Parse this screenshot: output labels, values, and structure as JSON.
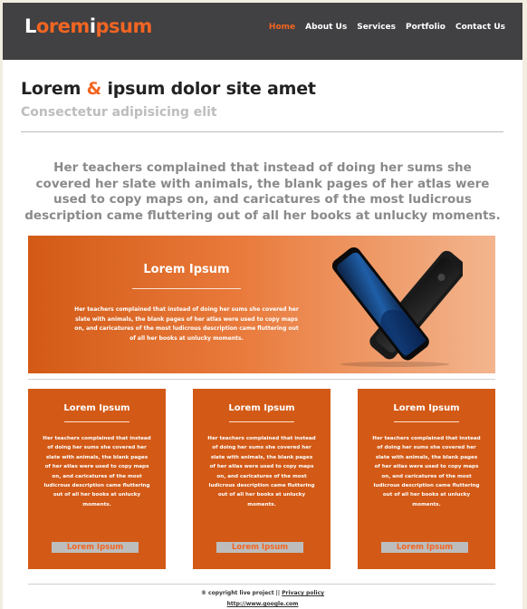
{
  "header": {
    "logo": {
      "part1": "L",
      "part2": "orem",
      "part3": "i",
      "part4": "psum"
    },
    "nav": [
      "Home",
      "About Us",
      "Services",
      "Portfolio",
      "Contact Us"
    ]
  },
  "main": {
    "title_part1": "Lorem",
    "title_amp": "&",
    "title_part2": "ipsum dolor site amet",
    "subtitle": "Consectetur adipisicing elit",
    "intro": "Her teachers complained that instead of doing her sums she covered her slate with animals, the blank pages of her atlas were used to copy maps on, and caricatures of the most ludicrous description came fluttering out of all her books at unlucky moments."
  },
  "hero": {
    "title": "Lorem Ipsum",
    "text": "Her teachers complained that instead of doing her sums she covered her slate with animals, the blank pages of her atlas were used to copy maps on, and caricatures of the most ludicrous description came fluttering out of all her books at unlucky moments."
  },
  "cards": [
    {
      "title": "Lorem Ipsum",
      "text": "Her teachers complained that instead of doing her sums she covered her slate with animals, the blank pages of her atlas were used to copy maps on, and caricatures of the most ludicrous description came fluttering out of all her books at unlucky moments.",
      "button": "Lorem Ipsum"
    },
    {
      "title": "Lorem Ipsum",
      "text": "Her teachers complained that instead of doing her sums she covered her slate with animals, the blank pages of her atlas were used to copy maps on, and caricatures of the most ludicrous description came fluttering out of all her books at unlucky moments.",
      "button": "Lorem Ipsum"
    },
    {
      "title": "Lorem Ipsum",
      "text": "Her teachers complained that instead of doing her sums she covered her slate with animals, the blank pages of her atlas were used to copy maps on, and caricatures of the most ludicrous description came fluttering out of all her books at unlucky moments.",
      "button": "Lorem Ipsum"
    }
  ],
  "footer": {
    "copyright": "® copyright live project ||",
    "privacy": "Privacy policy",
    "url": "http://www.google.com"
  },
  "colors": {
    "accent": "#f26522",
    "header_bg": "#414042",
    "card_bg": "#d35a16"
  }
}
